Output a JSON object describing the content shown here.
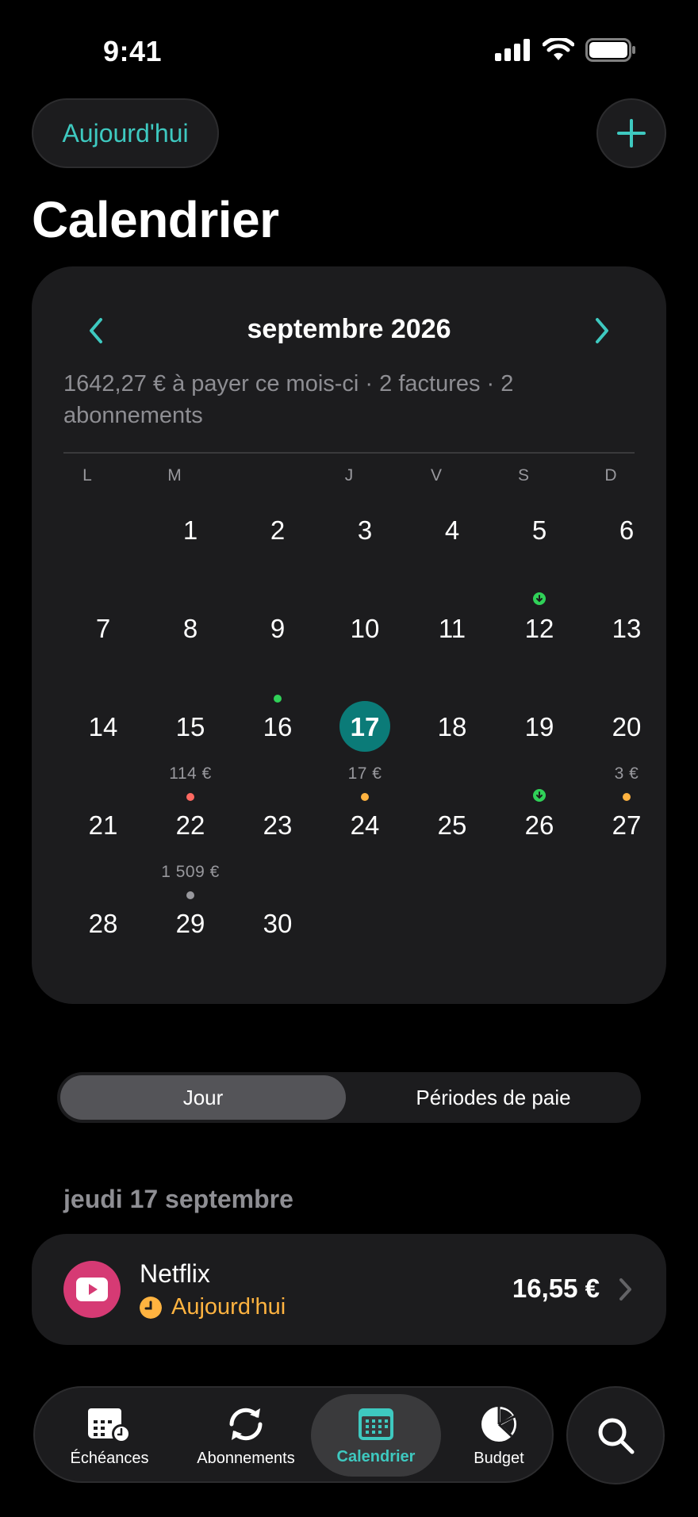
{
  "status_bar": {
    "time": "9:41"
  },
  "header": {
    "today_button": "Aujourd'hui",
    "add_icon": "plus-icon",
    "title": "Calendrier"
  },
  "calendar": {
    "month_title": "septembre 2026",
    "summary": "1642,27 € à payer ce mois-ci · 2 factures · 2 abonnements",
    "weekdays": [
      "L",
      "M",
      "J",
      "V",
      "S",
      "D"
    ],
    "days": [
      {
        "n": "1",
        "amount": "",
        "marker": ""
      },
      {
        "n": "2",
        "amount": "",
        "marker": ""
      },
      {
        "n": "3",
        "amount": "",
        "marker": ""
      },
      {
        "n": "4",
        "amount": "",
        "marker": ""
      },
      {
        "n": "5",
        "amount": "",
        "marker": "income"
      },
      {
        "n": "6",
        "amount": "",
        "marker": ""
      },
      {
        "n": "7",
        "amount": "",
        "marker": ""
      },
      {
        "n": "8",
        "amount": "",
        "marker": ""
      },
      {
        "n": "9",
        "amount": "",
        "marker": "green"
      },
      {
        "n": "10",
        "amount": "",
        "marker": ""
      },
      {
        "n": "11",
        "amount": "",
        "marker": ""
      },
      {
        "n": "12",
        "amount": "",
        "marker": ""
      },
      {
        "n": "13",
        "amount": "",
        "marker": ""
      },
      {
        "n": "14",
        "amount": "",
        "marker": ""
      },
      {
        "n": "15",
        "amount": "114 €",
        "marker": "red"
      },
      {
        "n": "16",
        "amount": "",
        "marker": ""
      },
      {
        "n": "17",
        "amount": "17 €",
        "marker": "orange",
        "today": true
      },
      {
        "n": "18",
        "amount": "",
        "marker": ""
      },
      {
        "n": "19",
        "amount": "",
        "marker": "income"
      },
      {
        "n": "20",
        "amount": "3 €",
        "marker": "orange"
      },
      {
        "n": "21",
        "amount": "",
        "marker": ""
      },
      {
        "n": "22",
        "amount": "1 509 €",
        "marker": "gray"
      },
      {
        "n": "23",
        "amount": "",
        "marker": ""
      },
      {
        "n": "24",
        "amount": "",
        "marker": ""
      },
      {
        "n": "25",
        "amount": "",
        "marker": ""
      },
      {
        "n": "26",
        "amount": "",
        "marker": ""
      },
      {
        "n": "27",
        "amount": "",
        "marker": ""
      },
      {
        "n": "28",
        "amount": "",
        "marker": ""
      },
      {
        "n": "29",
        "amount": "",
        "marker": ""
      },
      {
        "n": "30",
        "amount": "",
        "marker": ""
      }
    ],
    "marker_colors": {
      "green": "#30d158",
      "red": "#ff6961",
      "orange": "#ffb340",
      "gray": "#98989d",
      "income": "#30d158"
    },
    "today_color": "#0b7b78"
  },
  "segmented": {
    "active": "Jour",
    "other": "Périodes de paie"
  },
  "day_section": {
    "heading": "jeudi 17 septembre",
    "event": {
      "name": "Netflix",
      "status": "Aujourd'hui",
      "amount": "16,55 €",
      "icon": "play-icon"
    }
  },
  "tabbar": {
    "tabs": [
      {
        "label": "Échéances",
        "icon": "calendar-clock-icon"
      },
      {
        "label": "Abonnements",
        "icon": "refresh-icon"
      },
      {
        "label": "Calendrier",
        "icon": "calendar-icon",
        "active": true
      },
      {
        "label": "Budget",
        "icon": "pie-chart-icon"
      }
    ],
    "search_icon": "search-icon"
  },
  "accent_color": "#3ec9c0"
}
